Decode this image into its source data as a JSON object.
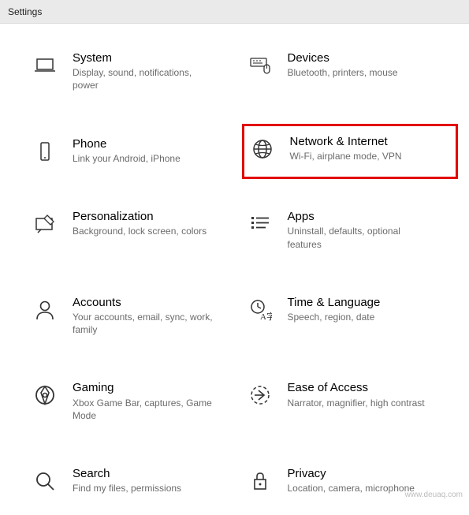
{
  "window": {
    "title": "Settings"
  },
  "tiles": [
    {
      "id": "system",
      "title": "System",
      "desc": "Display, sound, notifications, power",
      "icon": "laptop-icon",
      "highlighted": false
    },
    {
      "id": "devices",
      "title": "Devices",
      "desc": "Bluetooth, printers, mouse",
      "icon": "keyboard-mouse-icon",
      "highlighted": false
    },
    {
      "id": "phone",
      "title": "Phone",
      "desc": "Link your Android, iPhone",
      "icon": "phone-icon",
      "highlighted": false
    },
    {
      "id": "network",
      "title": "Network & Internet",
      "desc": "Wi-Fi, airplane mode, VPN",
      "icon": "globe-icon",
      "highlighted": true
    },
    {
      "id": "personalization",
      "title": "Personalization",
      "desc": "Background, lock screen, colors",
      "icon": "personalization-icon",
      "highlighted": false
    },
    {
      "id": "apps",
      "title": "Apps",
      "desc": "Uninstall, defaults, optional features",
      "icon": "apps-list-icon",
      "highlighted": false
    },
    {
      "id": "accounts",
      "title": "Accounts",
      "desc": "Your accounts, email, sync, work, family",
      "icon": "person-icon",
      "highlighted": false
    },
    {
      "id": "time-language",
      "title": "Time & Language",
      "desc": "Speech, region, date",
      "icon": "time-language-icon",
      "highlighted": false
    },
    {
      "id": "gaming",
      "title": "Gaming",
      "desc": "Xbox Game Bar, captures, Game Mode",
      "icon": "gaming-icon",
      "highlighted": false
    },
    {
      "id": "ease-of-access",
      "title": "Ease of Access",
      "desc": "Narrator, magnifier, high contrast",
      "icon": "ease-of-access-icon",
      "highlighted": false
    },
    {
      "id": "search",
      "title": "Search",
      "desc": "Find my files, permissions",
      "icon": "search-icon",
      "highlighted": false
    },
    {
      "id": "privacy",
      "title": "Privacy",
      "desc": "Location, camera, microphone",
      "icon": "lock-icon",
      "highlighted": false
    }
  ],
  "watermark": "www.deuaq.com"
}
